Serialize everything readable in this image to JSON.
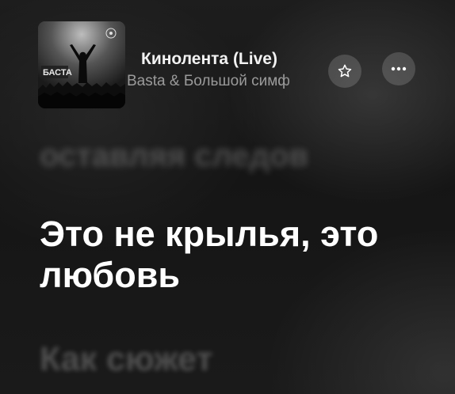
{
  "now_playing": {
    "artwork": {
      "icon": "album-cover-image",
      "cover_text": "БАСТА"
    },
    "title": "Кинолента (Live)",
    "artist": "Basta & Большой симф",
    "favorite_icon": "star-outline-icon",
    "more_icon": "ellipsis-icon"
  },
  "lyrics": {
    "previous_line": "оставляя следов",
    "current_line": [
      "Это не крылья, это",
      "любовь"
    ],
    "next_line": "Как сюжет"
  }
}
